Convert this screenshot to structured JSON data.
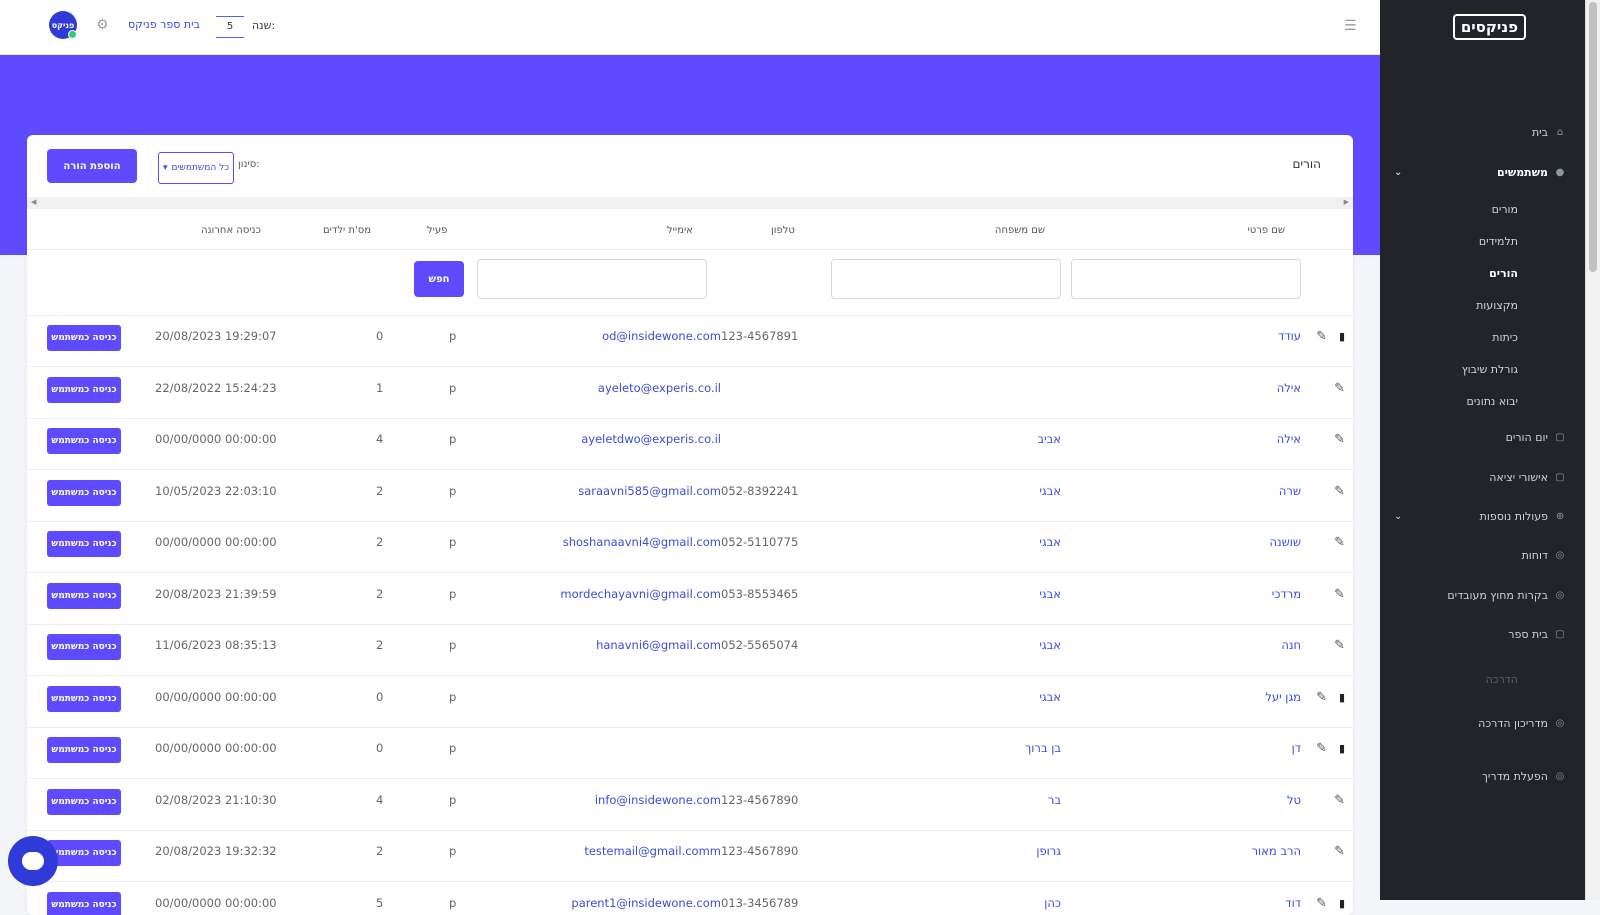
{
  "app": {
    "logo_text": "פניקסים"
  },
  "topbar": {
    "year_label": "שנה:",
    "year_value": "5",
    "school_link": "בית ספר פניקס",
    "avatar_text": "פניקס"
  },
  "sidebar": {
    "items": [
      {
        "label": "בית",
        "icon": "home-icon"
      },
      {
        "label": "משתמשים",
        "icon": "users-icon"
      },
      {
        "label": "מורים"
      },
      {
        "label": "תלמידים"
      },
      {
        "label": "הורים"
      },
      {
        "label": "מקצועות"
      },
      {
        "label": "כיתות"
      },
      {
        "label": "גורלת שיבוץ"
      },
      {
        "label": "יבוא נתונים"
      },
      {
        "label": "יום הורים",
        "icon": "calendar-icon"
      },
      {
        "label": "אישורי יציאה",
        "icon": "doc-icon"
      },
      {
        "label": "פעולות נוספות",
        "icon": "plus-icon"
      },
      {
        "label": "דוחות",
        "icon": "report-icon"
      },
      {
        "label": "בקרות מחוץ מעובדים",
        "icon": "shield-icon"
      },
      {
        "label": "בית ספר",
        "icon": "school-icon"
      },
      {
        "label": "הדרכה"
      },
      {
        "label": "מדריכון הדרכה",
        "icon": "book-icon"
      },
      {
        "label": "הפעלת מדריך",
        "icon": "play-icon"
      }
    ]
  },
  "card": {
    "title": "הורים",
    "add_button": "הוספת הורה",
    "filter_label": "סינון:",
    "filter_value": "כל המשתמשים",
    "search_button": "חפש"
  },
  "table": {
    "headers": {
      "first_name": "שם פרטי",
      "family": "שם משפחה",
      "phone": "טלפון",
      "email": "אימייל",
      "active": "פעיל",
      "kids": "מס'ת ילדים",
      "login": "כניסה אחרונה"
    },
    "impersonate_label": "כניסה כמשתמש",
    "rows": [
      {
        "name": "עודד",
        "family": "",
        "phone": "123-4567891",
        "email": "od@insidewone.com",
        "active": "p",
        "kids": "0",
        "login": "20/08/2023 19:29:07",
        "trash": true
      },
      {
        "name": "אילה",
        "family": "",
        "phone": "",
        "email": "ayeleto@experis.co.il",
        "active": "p",
        "kids": "1",
        "login": "22/08/2022 15:24:23",
        "trash": false
      },
      {
        "name": "אילה",
        "family": "אביב",
        "phone": "",
        "email": "ayeletdwo@experis.co.il",
        "active": "p",
        "kids": "4",
        "login": "00/00/0000 00:00:00",
        "trash": false
      },
      {
        "name": "שרה",
        "family": "אבגי",
        "phone": "052-8392241",
        "email": "saraavni585@gmail.com",
        "active": "p",
        "kids": "2",
        "login": "10/05/2023 22:03:10",
        "trash": false
      },
      {
        "name": "שושנה",
        "family": "אבגי",
        "phone": "052-5110775",
        "email": "shoshanaavni4@gmail.com",
        "active": "p",
        "kids": "2",
        "login": "00/00/0000 00:00:00",
        "trash": false
      },
      {
        "name": "מרדכי",
        "family": "אבגי",
        "phone": "053-8553465",
        "email": "mordechayavni@gmail.com",
        "active": "p",
        "kids": "2",
        "login": "20/08/2023 21:39:59",
        "trash": false
      },
      {
        "name": "חנה",
        "family": "אבגי",
        "phone": "052-5565074",
        "email": "hanavni6@gmail.com",
        "active": "p",
        "kids": "2",
        "login": "11/06/2023 08:35:13",
        "trash": false
      },
      {
        "name": "מגן יעל",
        "family": "אבגי",
        "phone": "",
        "email": "",
        "active": "p",
        "kids": "0",
        "login": "00/00/0000 00:00:00",
        "trash": true
      },
      {
        "name": "דן",
        "family": "בן ברוך",
        "phone": "",
        "email": "",
        "active": "p",
        "kids": "0",
        "login": "00/00/0000 00:00:00",
        "trash": true
      },
      {
        "name": "טל",
        "family": "בר",
        "phone": "123-4567890",
        "email": "info@insidewone.com",
        "active": "p",
        "kids": "4",
        "login": "02/08/2023 21:10:30",
        "trash": false
      },
      {
        "name": "הרב מאור",
        "family": "גרופן",
        "phone": "123-4567890",
        "email": "testemail@gmail.comm",
        "active": "p",
        "kids": "2",
        "login": "20/08/2023 19:32:32",
        "trash": false
      },
      {
        "name": "דוד",
        "family": "כהן",
        "phone": "013-3456789",
        "email": "parent1@insidewone.com",
        "active": "p",
        "kids": "5",
        "login": "00/00/0000 00:00:00",
        "trash": true
      }
    ]
  },
  "colors": {
    "accent": "#5f4bff",
    "sidebar": "#212529",
    "link": "#3b4cd9"
  }
}
